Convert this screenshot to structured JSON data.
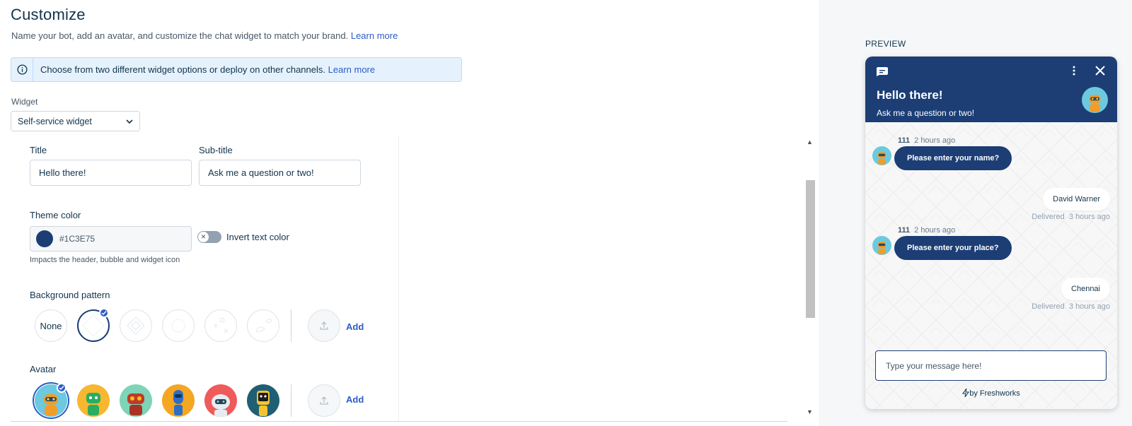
{
  "header": {
    "title": "Customize",
    "description": "Name your bot, add an avatar, and customize the chat widget to match your brand.",
    "learn_more": "Learn more"
  },
  "info_banner": {
    "text": "Choose from two different widget options or deploy on other channels.",
    "learn_more": "Learn more"
  },
  "widget_select": {
    "label": "Widget",
    "value": "Self-service widget"
  },
  "form": {
    "title_label": "Title",
    "title_value": "Hello there!",
    "subtitle_label": "Sub-title",
    "subtitle_value": "Ask me a question or two!",
    "theme_label": "Theme color",
    "theme_value": "#1C3E75",
    "invert_label": "Invert text color",
    "invert_on": false,
    "theme_hint": "Impacts the header, bubble and widget icon",
    "bg_label": "Background pattern",
    "bg_none": "None",
    "bg_selected_index": 1,
    "bg_add": "Add",
    "avatar_label": "Avatar",
    "avatar_selected_index": 0,
    "avatar_add": "Add"
  },
  "preview": {
    "label": "PREVIEW",
    "title": "Hello there!",
    "subtitle": "Ask me a question or two!",
    "messages": [
      {
        "type": "bot",
        "sender": "111",
        "time": "2 hours ago",
        "text": "Please enter your name?"
      },
      {
        "type": "user",
        "text": "David Warner",
        "status": "Delivered",
        "time": "3 hours ago"
      },
      {
        "type": "bot",
        "sender": "111",
        "time": "2 hours ago",
        "text": "Please enter your place?"
      },
      {
        "type": "user",
        "text": "Chennai",
        "status": "Delivered",
        "time": "3 hours ago"
      }
    ],
    "input_placeholder": "Type your message here!",
    "footer": "by Freshworks"
  },
  "colors": {
    "theme": "#1C3E75",
    "link": "#2c5cc5",
    "text": "#12344d"
  }
}
